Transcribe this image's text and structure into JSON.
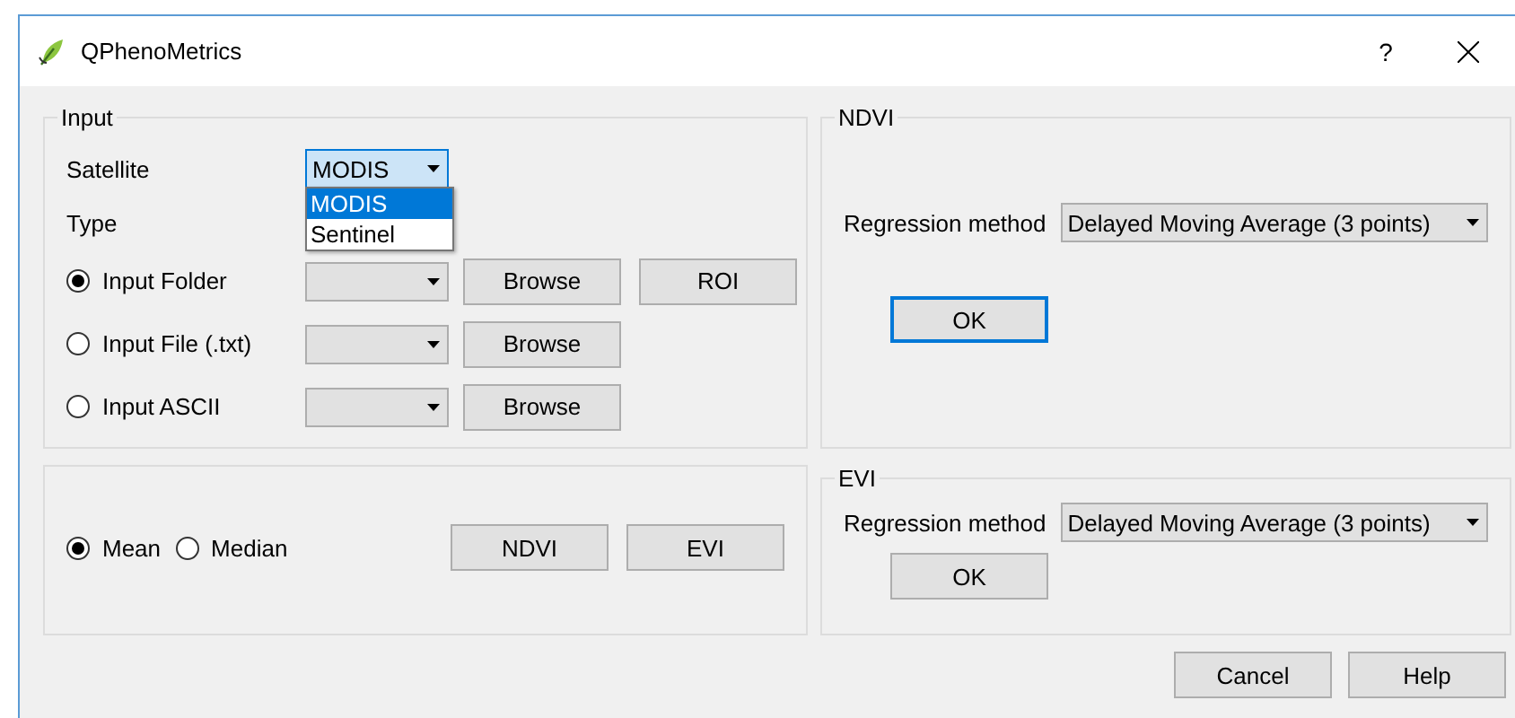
{
  "window": {
    "title": "QPhenoMetrics",
    "help": "?"
  },
  "input": {
    "title": "Input",
    "satellite_label": "Satellite",
    "satellite": {
      "value": "MODIS",
      "expanded": true,
      "options": [
        {
          "label": "MODIS",
          "selected": true
        },
        {
          "label": "Sentinel",
          "selected": false
        }
      ]
    },
    "type_label": "Type",
    "sources": [
      {
        "label": "Input Folder",
        "selected": true,
        "buttons": [
          "Browse",
          "ROI"
        ]
      },
      {
        "label": "Input File (.txt)",
        "selected": false,
        "buttons": [
          "Browse"
        ]
      },
      {
        "label": "Input ASCII",
        "selected": false,
        "buttons": [
          "Browse"
        ]
      }
    ]
  },
  "statistic": {
    "options": [
      {
        "label": "Mean",
        "selected": true
      },
      {
        "label": "Median",
        "selected": false
      }
    ],
    "buttons": [
      "NDVI",
      "EVI"
    ]
  },
  "ndvi": {
    "title": "NDVI",
    "label": "Regression method",
    "value": "Delayed Moving Average (3 points)",
    "ok": "OK",
    "ok_focused": true
  },
  "evi": {
    "title": "EVI",
    "label": "Regression method",
    "value": "Delayed Moving Average (3 points)",
    "ok": "OK",
    "ok_focused": false
  },
  "footer": [
    "Cancel",
    "Help"
  ]
}
